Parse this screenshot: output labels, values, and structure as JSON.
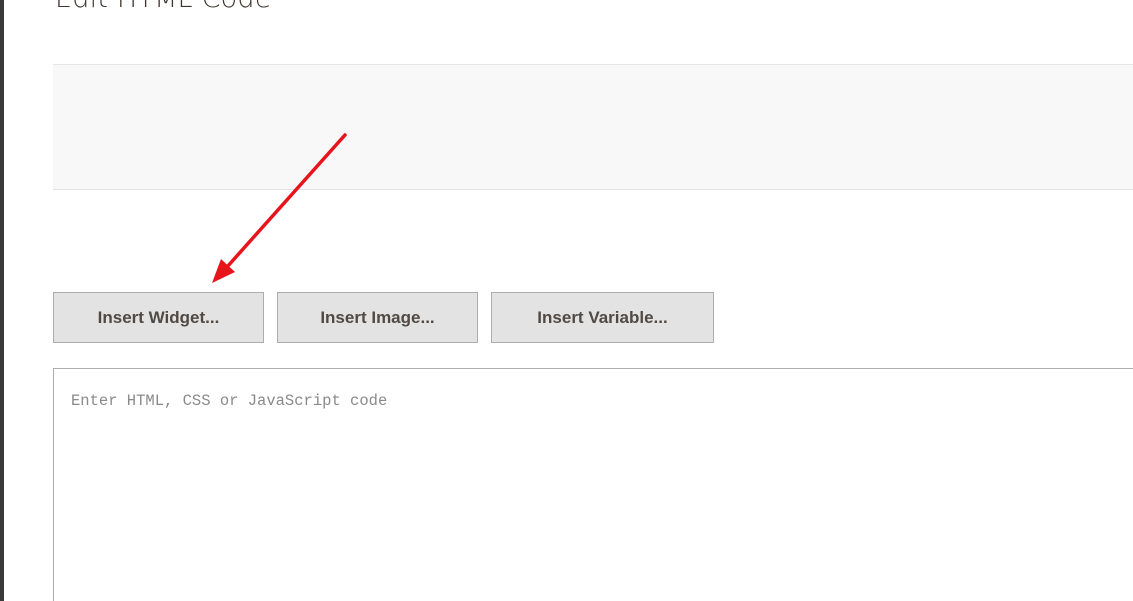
{
  "page": {
    "heading": "Edit HTML Code"
  },
  "toolbar": {
    "insert_widget_label": "Insert Widget...",
    "insert_image_label": "Insert Image...",
    "insert_variable_label": "Insert Variable..."
  },
  "editor": {
    "placeholder": "Enter HTML, CSS or JavaScript code",
    "value": ""
  },
  "colors": {
    "button_bg": "#e3e3e3",
    "button_border": "#adadad",
    "annotation_arrow": "#e8141c",
    "panel_bg": "#f8f8f8"
  },
  "annotation": {
    "type": "red-arrow",
    "points_to": "insert-widget-button"
  }
}
